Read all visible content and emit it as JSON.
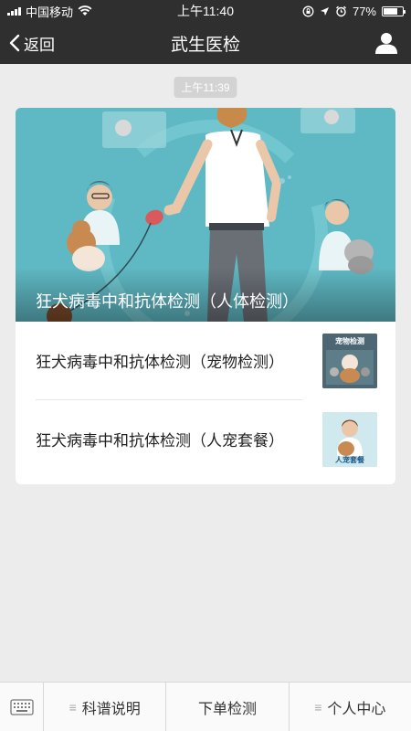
{
  "status": {
    "carrier": "中国移动",
    "time": "上午11:40",
    "battery": "77%",
    "battery_level": 0.77
  },
  "nav": {
    "back_label": "返回",
    "title": "武生医检"
  },
  "chat": {
    "timestamp": "上午11:39"
  },
  "article": {
    "main_title": "狂犬病毒中和抗体检测（人体检测）",
    "items": [
      {
        "label": "狂犬病毒中和抗体检测（宠物检测）",
        "thumb_text": "宠物检测"
      },
      {
        "label": "狂犬病毒中和抗体检测（人宠套餐）",
        "thumb_text": "人宠套餐"
      }
    ]
  },
  "tabbar": {
    "tabs": [
      "科谱说明",
      "下单检测",
      "个人中心"
    ]
  },
  "colors": {
    "header": "#2f2f2f",
    "hero": "#5fb9c4",
    "page_bg": "#ececec"
  }
}
